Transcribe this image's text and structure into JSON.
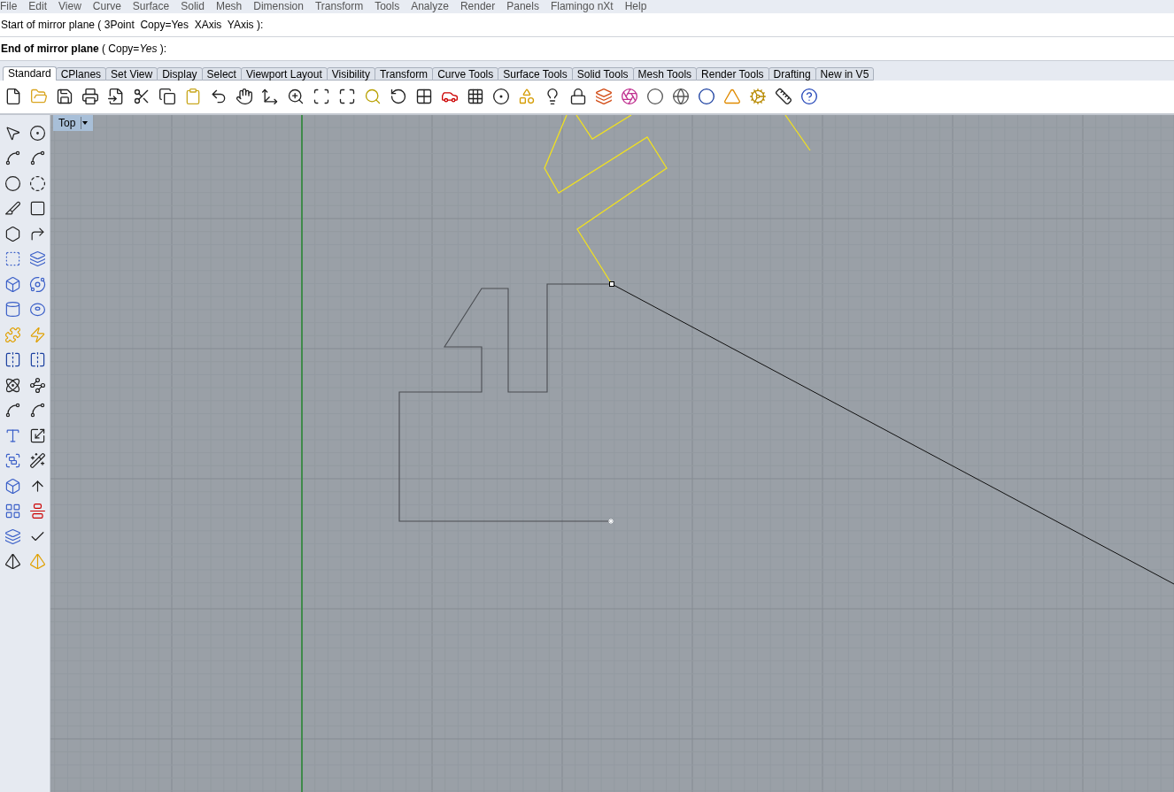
{
  "menu": [
    "File",
    "Edit",
    "View",
    "Curve",
    "Surface",
    "Solid",
    "Mesh",
    "Dimension",
    "Transform",
    "Tools",
    "Analyze",
    "Render",
    "Panels",
    "Flamingo nXt",
    "Help"
  ],
  "command_history": "Start of mirror plane ( 3Point  Copy=Yes  XAxis  YAxis ):",
  "command_prompt": "**End of mirror plane** ( Copy=*Yes* ):",
  "tabs": [
    {
      "label": "Standard",
      "selected": true
    },
    {
      "label": "CPlanes",
      "selected": false
    },
    {
      "label": "Set View",
      "selected": false
    },
    {
      "label": "Display",
      "selected": false
    },
    {
      "label": "Select",
      "selected": false
    },
    {
      "label": "Viewport Layout",
      "selected": false
    },
    {
      "label": "Visibility",
      "selected": false
    },
    {
      "label": "Transform",
      "selected": false
    },
    {
      "label": "Curve Tools",
      "selected": false
    },
    {
      "label": "Surface Tools",
      "selected": false
    },
    {
      "label": "Solid Tools",
      "selected": false
    },
    {
      "label": "Mesh Tools",
      "selected": false
    },
    {
      "label": "Render Tools",
      "selected": false
    },
    {
      "label": "Drafting",
      "selected": false
    },
    {
      "label": "New in V5",
      "selected": false
    }
  ],
  "viewport": {
    "title": "Top"
  }
}
